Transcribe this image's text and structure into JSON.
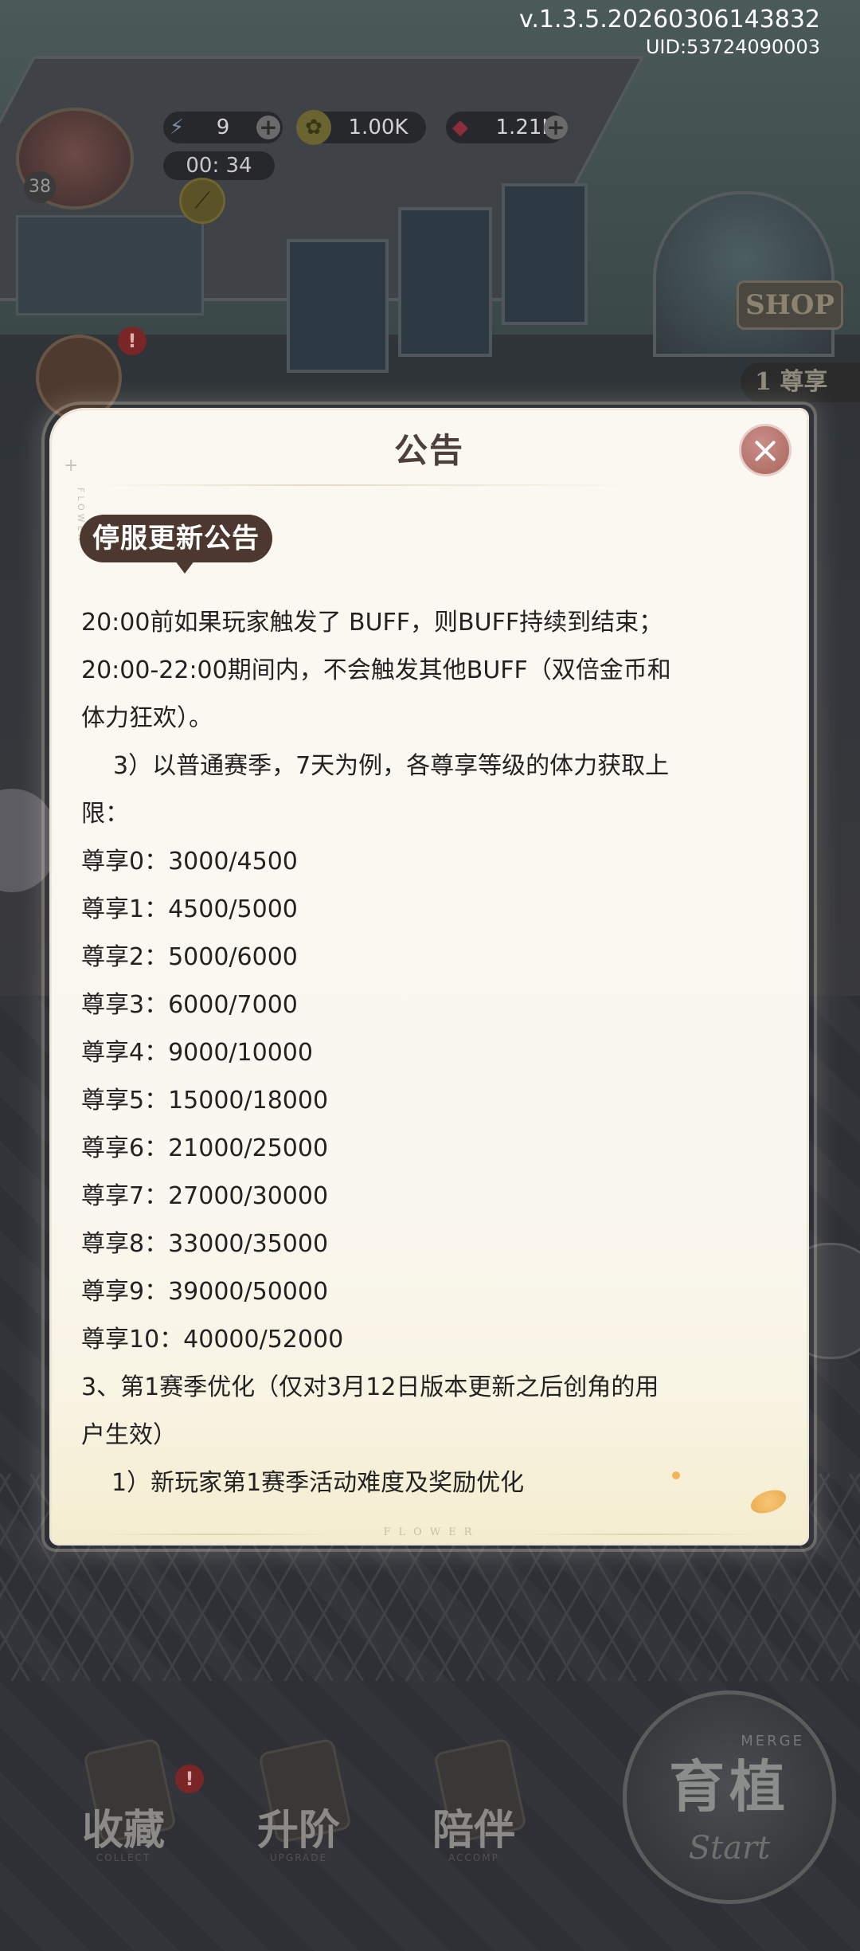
{
  "hud": {
    "version": "v.1.3.5.20260306143832",
    "uid": "UID:53724090003",
    "level": "38",
    "energy": "9",
    "energy_timer": "00: 34",
    "coins": "1.00K",
    "gems": "1.21K"
  },
  "background": {
    "shop_sign": "SHOP",
    "rank_badge": "1 尊享",
    "bottom_nav": [
      {
        "label": "收藏",
        "sub": "COLLECT"
      },
      {
        "label": "升阶",
        "sub": "UPGRADE"
      },
      {
        "label": "陪伴",
        "sub": "ACCOMP"
      }
    ],
    "merge_title": "育植",
    "merge_sub": "MERGE",
    "merge_start": "Start"
  },
  "modal": {
    "title": "公告",
    "deco_text": "FLOWER",
    "footer_text": "FLOWER",
    "section_tag": "停服更新公告",
    "lines": [
      "20:00前如果玩家触发了 BUFF，则BUFF持续到结束；",
      "20:00-22:00期间内，不会触发其他BUFF（双倍金币和",
      "体力狂欢）。",
      "3）以普通赛季，7天为例，各尊享等级的体力获取上",
      "限：",
      "尊享0：3000/4500",
      "尊享1：4500/5000",
      "尊享2：5000/6000",
      "尊享3：6000/7000",
      "尊享4：9000/10000",
      "尊享5：15000/18000",
      "尊享6：21000/25000",
      "尊享7：27000/30000",
      "尊享8：33000/35000",
      "尊享9：39000/50000",
      "尊享10：40000/52000",
      "3、第1赛季优化（仅对3月12日版本更新之后创角的用",
      "户生效）",
      "1）新玩家第1赛季活动难度及奖励优化"
    ]
  },
  "colors": {
    "modal_bg": "#faf7f0",
    "tag_bg": "#4d3830",
    "close_btn": "#b8756d"
  }
}
